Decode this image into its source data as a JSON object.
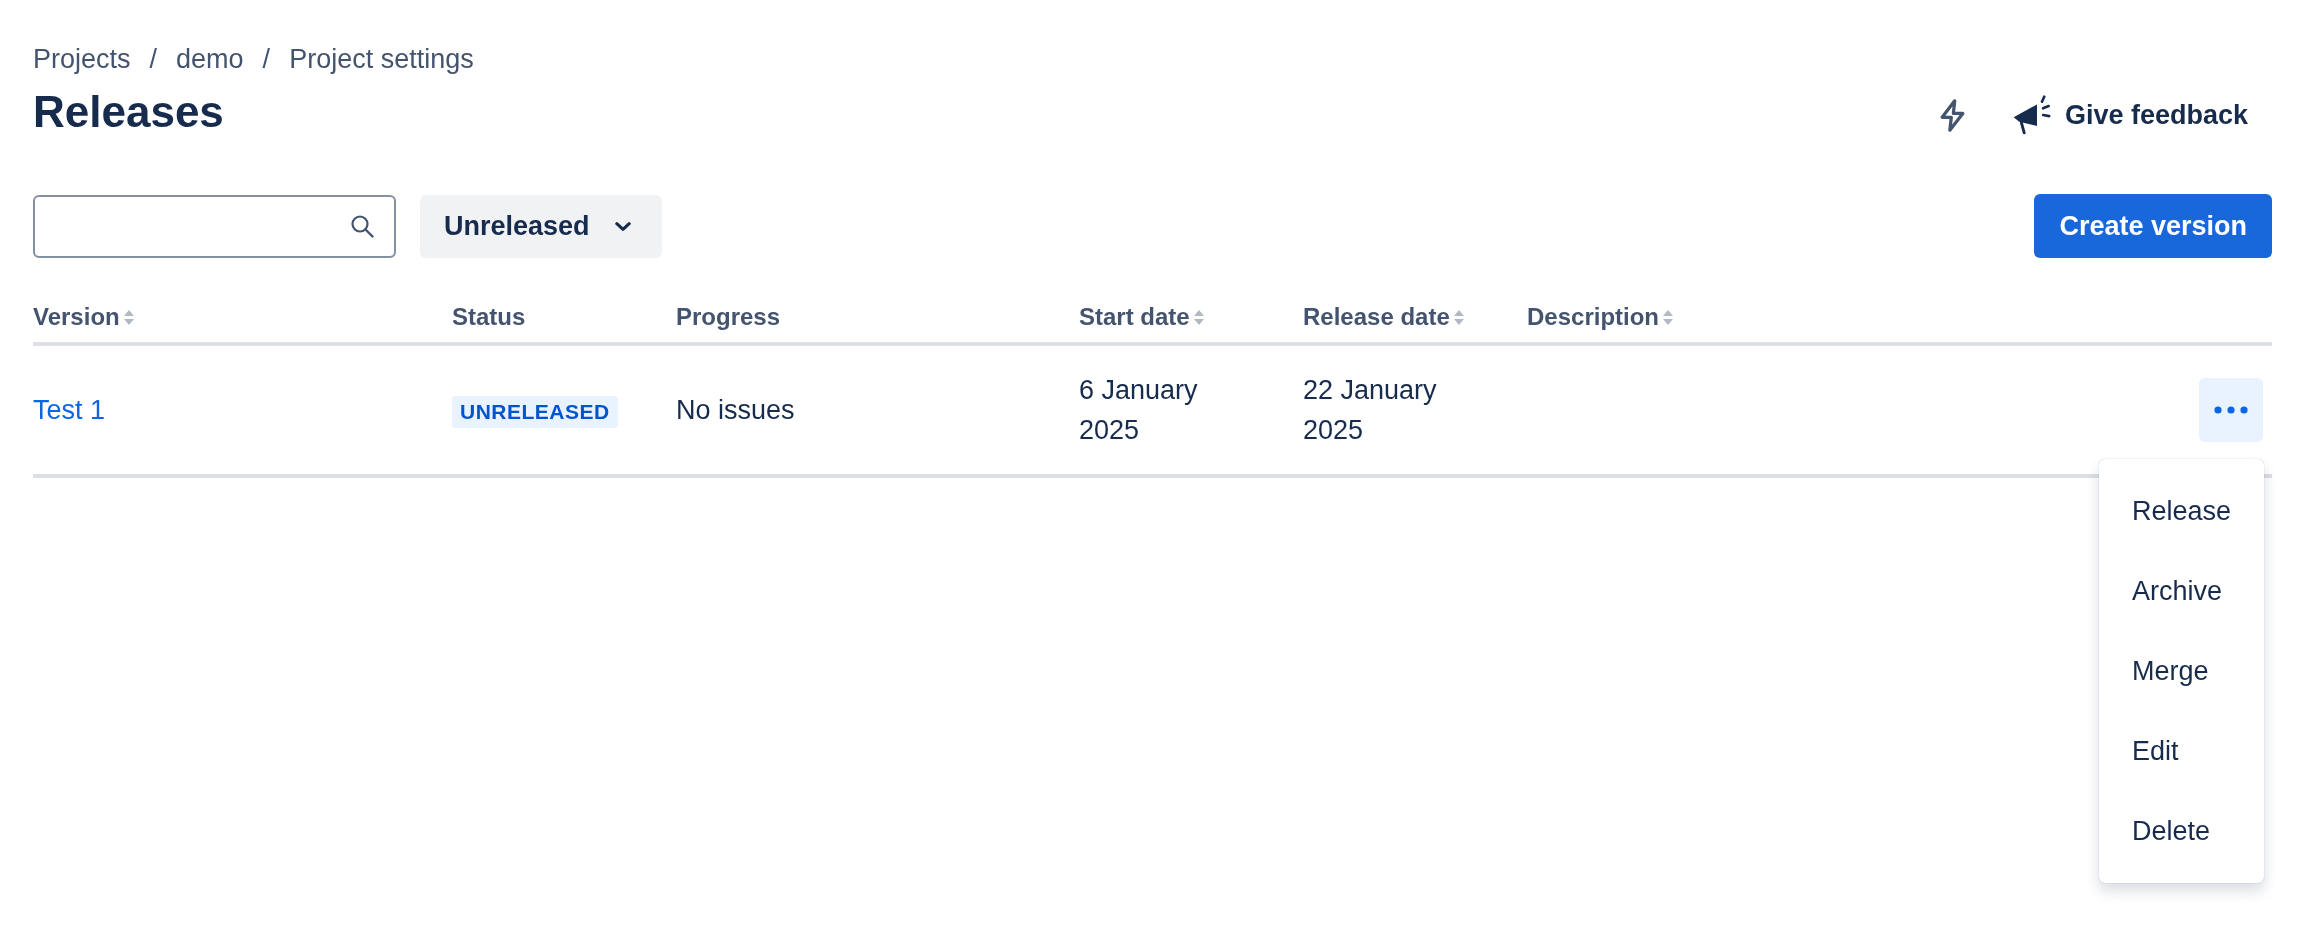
{
  "breadcrumbs": [
    {
      "label": "Projects"
    },
    {
      "separator": "/",
      "label": "demo"
    },
    {
      "separator": "/",
      "label": "Project settings"
    }
  ],
  "title": "Releases",
  "header_actions": {
    "feedback_button": "Give feedback"
  },
  "toolbar": {
    "filter": {
      "value": "Unreleased"
    },
    "create_button": "Create version"
  },
  "table": {
    "columns": [
      {
        "label": "Version",
        "sortable": true
      },
      {
        "label": "Status",
        "sortable": false
      },
      {
        "label": "Progress",
        "sortable": false
      },
      {
        "label": "Start date",
        "sortable": true
      },
      {
        "label": "Release date",
        "sortable": true
      },
      {
        "label": "Description",
        "sortable": true
      }
    ],
    "rows": [
      {
        "version": "Test 1",
        "status": "UNRELEASED",
        "progress": "No issues",
        "start_date": "6 January 2025",
        "release_date": "22 January 2025",
        "menu": {
          "expanded": true,
          "items": [
            "Release",
            "Archive",
            "Merge",
            "Edit",
            "Delete"
          ]
        }
      }
    ]
  }
}
